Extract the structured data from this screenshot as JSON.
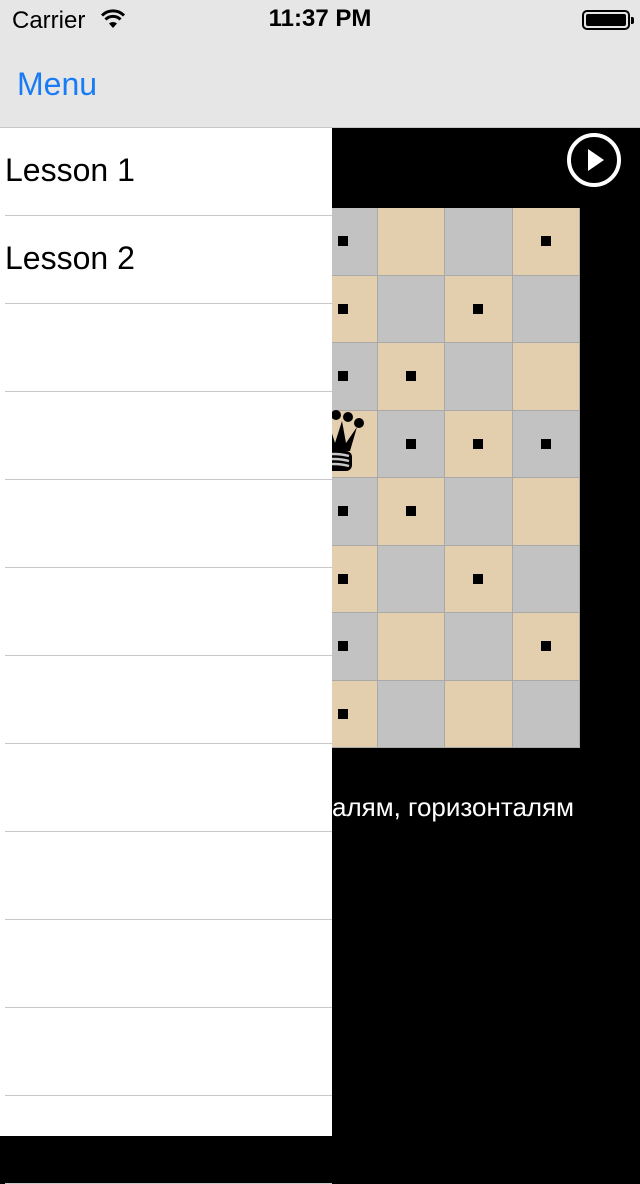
{
  "status_bar": {
    "carrier": "Carrier",
    "time": "11:37 PM",
    "wifi_icon": "wifi-icon",
    "battery_icon": "battery-icon"
  },
  "nav": {
    "menu_label": "Menu"
  },
  "sidebar": {
    "items": [
      {
        "label": "Lesson 1"
      },
      {
        "label": "Lesson 2"
      },
      {
        "label": ""
      },
      {
        "label": ""
      },
      {
        "label": ""
      },
      {
        "label": ""
      },
      {
        "label": ""
      },
      {
        "label": ""
      },
      {
        "label": ""
      },
      {
        "label": ""
      },
      {
        "label": ""
      },
      {
        "label": ""
      }
    ]
  },
  "lesson": {
    "play_icon": "play-circle-icon",
    "caption": "алям, горизонталям",
    "colors": {
      "light": "#e3cead",
      "dark": "#c2c2c2"
    },
    "board": [
      [
        "dark",
        "light",
        "dark",
        "light"
      ],
      [
        "light",
        "dark",
        "light",
        "dark"
      ],
      [
        "dark",
        "light",
        "dark",
        "light"
      ],
      [
        "light",
        "dark",
        "light",
        "dark"
      ],
      [
        "dark",
        "light",
        "dark",
        "light"
      ],
      [
        "light",
        "dark",
        "light",
        "dark"
      ],
      [
        "dark",
        "light",
        "dark",
        "light"
      ],
      [
        "light",
        "dark",
        "light",
        "dark"
      ]
    ],
    "marked_squares": [
      [
        0,
        0
      ],
      [
        0,
        3
      ],
      [
        1,
        0
      ],
      [
        1,
        2
      ],
      [
        2,
        0
      ],
      [
        2,
        1
      ],
      [
        3,
        1
      ],
      [
        3,
        2
      ],
      [
        3,
        3
      ],
      [
        4,
        0
      ],
      [
        4,
        1
      ],
      [
        5,
        0
      ],
      [
        5,
        2
      ],
      [
        6,
        0
      ],
      [
        6,
        3
      ],
      [
        7,
        0
      ]
    ],
    "queen_square": [
      3,
      0
    ],
    "queen_icon": "black-queen-icon"
  }
}
